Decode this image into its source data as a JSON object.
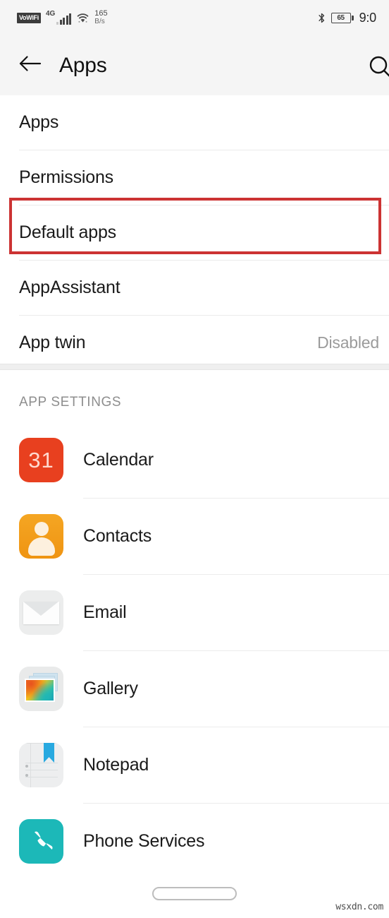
{
  "statusbar": {
    "vowifi_label": "VoWiFi",
    "network_type": "4G",
    "net_speed_value": "165",
    "net_speed_unit": "B/s",
    "battery_level": "65",
    "clock": "9:0",
    "icons": {
      "signal": "signal-bars-icon",
      "wifi": "wifi-icon",
      "bluetooth": "bluetooth-icon",
      "battery": "battery-icon"
    }
  },
  "appbar": {
    "title": "Apps",
    "back_icon": "back-arrow-icon",
    "search_icon": "search-icon"
  },
  "settings": {
    "rows": [
      {
        "label": "Apps",
        "value": "",
        "highlighted": false
      },
      {
        "label": "Permissions",
        "value": "",
        "highlighted": false
      },
      {
        "label": "Default apps",
        "value": "",
        "highlighted": true
      },
      {
        "label": "AppAssistant",
        "value": "",
        "highlighted": false
      },
      {
        "label": "App twin",
        "value": "Disabled",
        "highlighted": false
      }
    ]
  },
  "app_settings": {
    "header": "APP SETTINGS",
    "apps": [
      {
        "name": "Calendar",
        "icon": "calendar-icon",
        "icon_text": "31"
      },
      {
        "name": "Contacts",
        "icon": "contacts-icon",
        "icon_text": ""
      },
      {
        "name": "Email",
        "icon": "email-icon",
        "icon_text": ""
      },
      {
        "name": "Gallery",
        "icon": "gallery-icon",
        "icon_text": ""
      },
      {
        "name": "Notepad",
        "icon": "notepad-icon",
        "icon_text": ""
      },
      {
        "name": "Phone Services",
        "icon": "phone-services-icon",
        "icon_text": ""
      }
    ]
  },
  "navbar": {
    "gesture_pill": "home-gesture-pill"
  },
  "watermark": "wsxdn.com",
  "colors": {
    "highlight_red": "#cc3333",
    "calendar_red": "#e8401f",
    "contacts_orange": "#f5a623",
    "phone_teal": "#1cb8b8",
    "notepad_blue": "#28a9e0",
    "header_bg": "#f5f5f5"
  }
}
